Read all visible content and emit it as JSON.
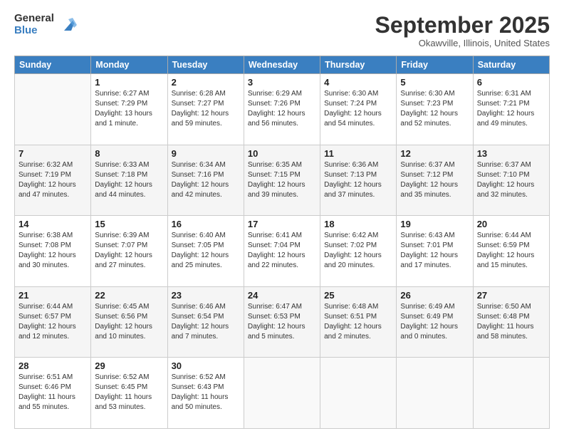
{
  "logo": {
    "general": "General",
    "blue": "Blue"
  },
  "title": "September 2025",
  "location": "Okawville, Illinois, United States",
  "days_of_week": [
    "Sunday",
    "Monday",
    "Tuesday",
    "Wednesday",
    "Thursday",
    "Friday",
    "Saturday"
  ],
  "weeks": [
    [
      {
        "day": "",
        "sunrise": "",
        "sunset": "",
        "daylight": ""
      },
      {
        "day": "1",
        "sunrise": "Sunrise: 6:27 AM",
        "sunset": "Sunset: 7:29 PM",
        "daylight": "Daylight: 13 hours and 1 minute."
      },
      {
        "day": "2",
        "sunrise": "Sunrise: 6:28 AM",
        "sunset": "Sunset: 7:27 PM",
        "daylight": "Daylight: 12 hours and 59 minutes."
      },
      {
        "day": "3",
        "sunrise": "Sunrise: 6:29 AM",
        "sunset": "Sunset: 7:26 PM",
        "daylight": "Daylight: 12 hours and 56 minutes."
      },
      {
        "day": "4",
        "sunrise": "Sunrise: 6:30 AM",
        "sunset": "Sunset: 7:24 PM",
        "daylight": "Daylight: 12 hours and 54 minutes."
      },
      {
        "day": "5",
        "sunrise": "Sunrise: 6:30 AM",
        "sunset": "Sunset: 7:23 PM",
        "daylight": "Daylight: 12 hours and 52 minutes."
      },
      {
        "day": "6",
        "sunrise": "Sunrise: 6:31 AM",
        "sunset": "Sunset: 7:21 PM",
        "daylight": "Daylight: 12 hours and 49 minutes."
      }
    ],
    [
      {
        "day": "7",
        "sunrise": "Sunrise: 6:32 AM",
        "sunset": "Sunset: 7:19 PM",
        "daylight": "Daylight: 12 hours and 47 minutes."
      },
      {
        "day": "8",
        "sunrise": "Sunrise: 6:33 AM",
        "sunset": "Sunset: 7:18 PM",
        "daylight": "Daylight: 12 hours and 44 minutes."
      },
      {
        "day": "9",
        "sunrise": "Sunrise: 6:34 AM",
        "sunset": "Sunset: 7:16 PM",
        "daylight": "Daylight: 12 hours and 42 minutes."
      },
      {
        "day": "10",
        "sunrise": "Sunrise: 6:35 AM",
        "sunset": "Sunset: 7:15 PM",
        "daylight": "Daylight: 12 hours and 39 minutes."
      },
      {
        "day": "11",
        "sunrise": "Sunrise: 6:36 AM",
        "sunset": "Sunset: 7:13 PM",
        "daylight": "Daylight: 12 hours and 37 minutes."
      },
      {
        "day": "12",
        "sunrise": "Sunrise: 6:37 AM",
        "sunset": "Sunset: 7:12 PM",
        "daylight": "Daylight: 12 hours and 35 minutes."
      },
      {
        "day": "13",
        "sunrise": "Sunrise: 6:37 AM",
        "sunset": "Sunset: 7:10 PM",
        "daylight": "Daylight: 12 hours and 32 minutes."
      }
    ],
    [
      {
        "day": "14",
        "sunrise": "Sunrise: 6:38 AM",
        "sunset": "Sunset: 7:08 PM",
        "daylight": "Daylight: 12 hours and 30 minutes."
      },
      {
        "day": "15",
        "sunrise": "Sunrise: 6:39 AM",
        "sunset": "Sunset: 7:07 PM",
        "daylight": "Daylight: 12 hours and 27 minutes."
      },
      {
        "day": "16",
        "sunrise": "Sunrise: 6:40 AM",
        "sunset": "Sunset: 7:05 PM",
        "daylight": "Daylight: 12 hours and 25 minutes."
      },
      {
        "day": "17",
        "sunrise": "Sunrise: 6:41 AM",
        "sunset": "Sunset: 7:04 PM",
        "daylight": "Daylight: 12 hours and 22 minutes."
      },
      {
        "day": "18",
        "sunrise": "Sunrise: 6:42 AM",
        "sunset": "Sunset: 7:02 PM",
        "daylight": "Daylight: 12 hours and 20 minutes."
      },
      {
        "day": "19",
        "sunrise": "Sunrise: 6:43 AM",
        "sunset": "Sunset: 7:01 PM",
        "daylight": "Daylight: 12 hours and 17 minutes."
      },
      {
        "day": "20",
        "sunrise": "Sunrise: 6:44 AM",
        "sunset": "Sunset: 6:59 PM",
        "daylight": "Daylight: 12 hours and 15 minutes."
      }
    ],
    [
      {
        "day": "21",
        "sunrise": "Sunrise: 6:44 AM",
        "sunset": "Sunset: 6:57 PM",
        "daylight": "Daylight: 12 hours and 12 minutes."
      },
      {
        "day": "22",
        "sunrise": "Sunrise: 6:45 AM",
        "sunset": "Sunset: 6:56 PM",
        "daylight": "Daylight: 12 hours and 10 minutes."
      },
      {
        "day": "23",
        "sunrise": "Sunrise: 6:46 AM",
        "sunset": "Sunset: 6:54 PM",
        "daylight": "Daylight: 12 hours and 7 minutes."
      },
      {
        "day": "24",
        "sunrise": "Sunrise: 6:47 AM",
        "sunset": "Sunset: 6:53 PM",
        "daylight": "Daylight: 12 hours and 5 minutes."
      },
      {
        "day": "25",
        "sunrise": "Sunrise: 6:48 AM",
        "sunset": "Sunset: 6:51 PM",
        "daylight": "Daylight: 12 hours and 2 minutes."
      },
      {
        "day": "26",
        "sunrise": "Sunrise: 6:49 AM",
        "sunset": "Sunset: 6:49 PM",
        "daylight": "Daylight: 12 hours and 0 minutes."
      },
      {
        "day": "27",
        "sunrise": "Sunrise: 6:50 AM",
        "sunset": "Sunset: 6:48 PM",
        "daylight": "Daylight: 11 hours and 58 minutes."
      }
    ],
    [
      {
        "day": "28",
        "sunrise": "Sunrise: 6:51 AM",
        "sunset": "Sunset: 6:46 PM",
        "daylight": "Daylight: 11 hours and 55 minutes."
      },
      {
        "day": "29",
        "sunrise": "Sunrise: 6:52 AM",
        "sunset": "Sunset: 6:45 PM",
        "daylight": "Daylight: 11 hours and 53 minutes."
      },
      {
        "day": "30",
        "sunrise": "Sunrise: 6:52 AM",
        "sunset": "Sunset: 6:43 PM",
        "daylight": "Daylight: 11 hours and 50 minutes."
      },
      {
        "day": "",
        "sunrise": "",
        "sunset": "",
        "daylight": ""
      },
      {
        "day": "",
        "sunrise": "",
        "sunset": "",
        "daylight": ""
      },
      {
        "day": "",
        "sunrise": "",
        "sunset": "",
        "daylight": ""
      },
      {
        "day": "",
        "sunrise": "",
        "sunset": "",
        "daylight": ""
      }
    ]
  ]
}
